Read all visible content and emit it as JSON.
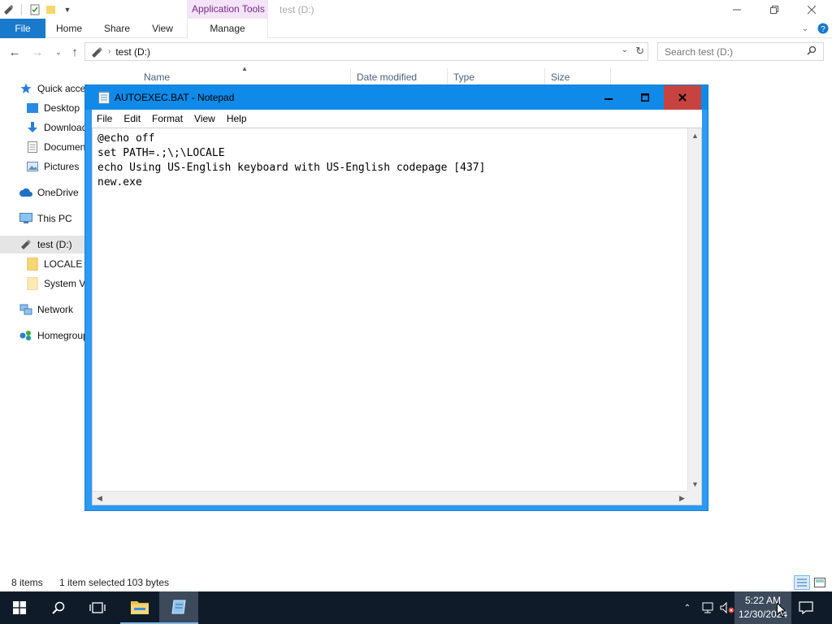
{
  "explorer": {
    "window_title": "test (D:)",
    "contextual_tab": "Application Tools",
    "ribbon_tabs": [
      "File",
      "Home",
      "Share",
      "View",
      "Manage"
    ],
    "address_crumb": "test (D:)",
    "search_placeholder": "Search test (D:)",
    "columns": [
      "Name",
      "Date modified",
      "Type",
      "Size"
    ],
    "nav_items": [
      {
        "label": "Quick access",
        "icon": "star-icon"
      },
      {
        "label": "Desktop",
        "icon": "desktop-icon"
      },
      {
        "label": "Downloads",
        "icon": "download-icon"
      },
      {
        "label": "Documents",
        "icon": "documents-icon"
      },
      {
        "label": "Pictures",
        "icon": "pictures-icon"
      },
      {
        "label": "OneDrive",
        "icon": "cloud-icon"
      },
      {
        "label": "This PC",
        "icon": "computer-icon"
      },
      {
        "label": "test (D:)",
        "icon": "drive-icon"
      },
      {
        "label": "LOCALE",
        "icon": "folder-icon"
      },
      {
        "label": "System Volume Information",
        "icon": "folder-icon"
      },
      {
        "label": "Network",
        "icon": "network-icon"
      },
      {
        "label": "Homegroup",
        "icon": "homegroup-icon"
      }
    ],
    "status": {
      "items_count": "8 items",
      "selected": "1 item selected",
      "size": "103 bytes"
    }
  },
  "notepad": {
    "title": "AUTOEXEC.BAT - Notepad",
    "menu": [
      "File",
      "Edit",
      "Format",
      "View",
      "Help"
    ],
    "content": "@echo off\nset PATH=.;\\;\\LOCALE\necho Using US-English keyboard with US-English codepage [437]\nnew.exe"
  },
  "taskbar": {
    "time": "5:22 AM",
    "date": "12/30/2024"
  },
  "colors": {
    "file_tab": "#1979ca",
    "notepad_frame": "#2b9af3",
    "close_button": "#c7433f",
    "taskbar": "#101b2a"
  }
}
